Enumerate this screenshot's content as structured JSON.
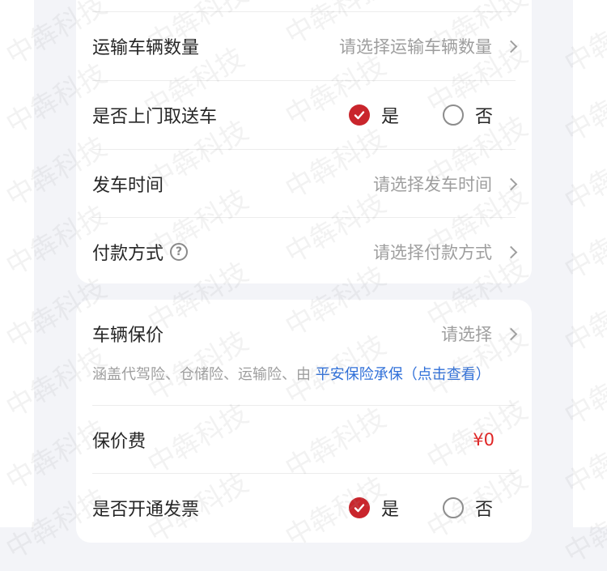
{
  "card1": {
    "rows": [
      {
        "label": "运输车辆数量",
        "value": "请选择运输车辆数量"
      },
      {
        "label": "是否上门取送车",
        "options": [
          "是",
          "否"
        ],
        "selected": "是"
      },
      {
        "label": "发车时间",
        "value": "请选择发车时间"
      },
      {
        "label": "付款方式",
        "value": "请选择付款方式",
        "help_icon": "question-circle-icon"
      }
    ]
  },
  "card2": {
    "insurance": {
      "label": "车辆保价",
      "value": "请选择",
      "note_prefix": "涵盖代驾险、仓储险、运输险、由",
      "note_link": "平安保险承保（点击查看）"
    },
    "fee": {
      "label": "保价费",
      "value": "¥0"
    },
    "invoice": {
      "label": "是否开通发票",
      "options": [
        "是",
        "否"
      ],
      "selected": "是"
    }
  },
  "watermark": "中犇科技",
  "colors": {
    "accent": "#c9252c",
    "link": "#2f6fd8",
    "price": "#e02424"
  }
}
